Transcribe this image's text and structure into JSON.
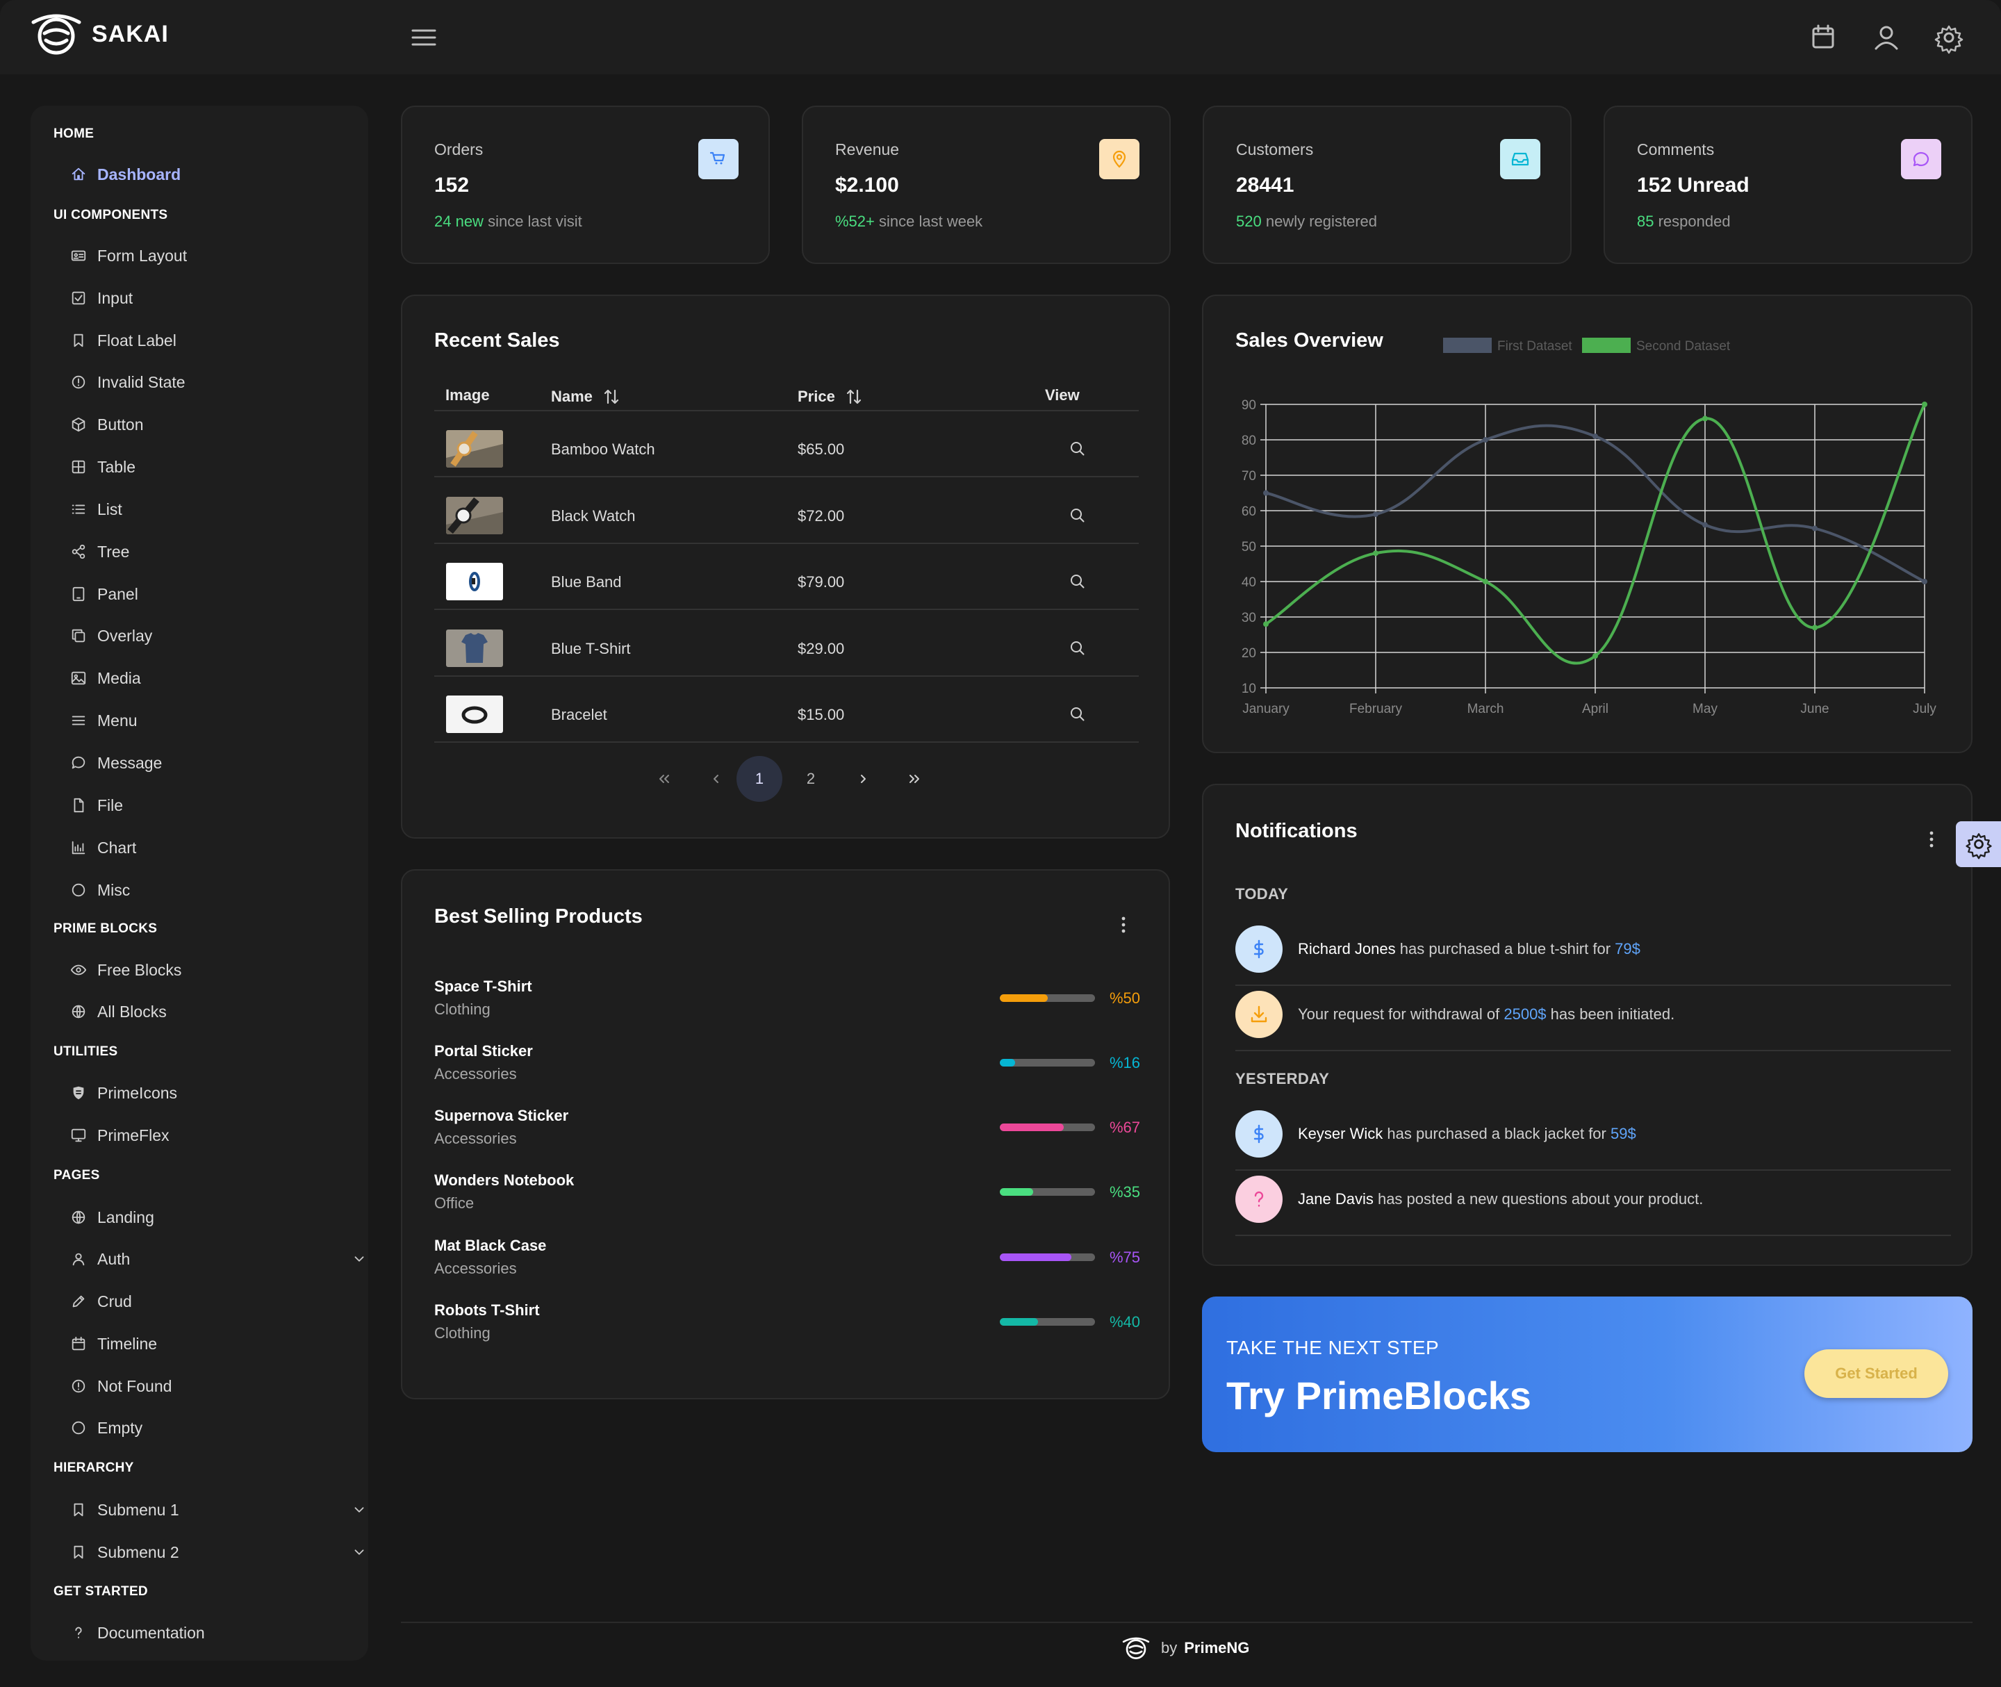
{
  "app": {
    "name": "SAKAI"
  },
  "sidebar": {
    "sections": [
      {
        "label": "HOME",
        "items": [
          {
            "label": "Dashboard",
            "icon": "home-icon"
          }
        ]
      },
      {
        "label": "UI COMPONENTS",
        "items": [
          {
            "label": "Form Layout",
            "icon": "id-card-icon"
          },
          {
            "label": "Input",
            "icon": "check-square-icon"
          },
          {
            "label": "Float Label",
            "icon": "bookmark-icon"
          },
          {
            "label": "Invalid State",
            "icon": "exclamation-circle-icon"
          },
          {
            "label": "Button",
            "icon": "box-icon"
          },
          {
            "label": "Table",
            "icon": "table-icon"
          },
          {
            "label": "List",
            "icon": "list-icon"
          },
          {
            "label": "Tree",
            "icon": "share-alt-icon"
          },
          {
            "label": "Panel",
            "icon": "tablet-icon"
          },
          {
            "label": "Overlay",
            "icon": "clone-icon"
          },
          {
            "label": "Media",
            "icon": "image-icon"
          },
          {
            "label": "Menu",
            "icon": "bars-icon"
          },
          {
            "label": "Message",
            "icon": "comment-icon"
          },
          {
            "label": "File",
            "icon": "file-icon"
          },
          {
            "label": "Chart",
            "icon": "chart-bar-icon"
          },
          {
            "label": "Misc",
            "icon": "circle-icon"
          }
        ]
      },
      {
        "label": "PRIME BLOCKS",
        "items": [
          {
            "label": "Free Blocks",
            "icon": "eye-icon"
          },
          {
            "label": "All Blocks",
            "icon": "globe-icon"
          }
        ]
      },
      {
        "label": "UTILITIES",
        "items": [
          {
            "label": "PrimeIcons",
            "icon": "prime-icon"
          },
          {
            "label": "PrimeFlex",
            "icon": "desktop-icon"
          }
        ]
      },
      {
        "label": "PAGES",
        "items": [
          {
            "label": "Landing",
            "icon": "globe-icon"
          },
          {
            "label": "Auth",
            "icon": "user-icon"
          },
          {
            "label": "Crud",
            "icon": "pencil-icon"
          },
          {
            "label": "Timeline",
            "icon": "calendar-icon"
          },
          {
            "label": "Not Found",
            "icon": "exclamation-circle-icon"
          },
          {
            "label": "Empty",
            "icon": "circle-icon"
          }
        ]
      },
      {
        "label": "HIERARCHY",
        "items": [
          {
            "label": "Submenu 1",
            "icon": "bookmark-icon"
          },
          {
            "label": "Submenu 2",
            "icon": "bookmark-icon"
          }
        ]
      },
      {
        "label": "GET STARTED",
        "items": [
          {
            "label": "Documentation",
            "icon": "question-icon"
          }
        ]
      }
    ]
  },
  "stats": [
    {
      "title": "Orders",
      "value": "152",
      "highlight": "24 new",
      "sub": " since last visit",
      "icon": "shopping-cart-icon",
      "icon_bg": "#cfe5fb",
      "icon_color": "#3b82f6"
    },
    {
      "title": "Revenue",
      "value": "$2.100",
      "highlight": "%52+",
      "sub": " since last week",
      "icon": "map-marker-icon",
      "icon_bg": "#fde2b8",
      "icon_color": "#f59e0b"
    },
    {
      "title": "Customers",
      "value": "28441",
      "highlight": "520",
      "sub": " newly registered",
      "icon": "inbox-icon",
      "icon_bg": "#c6eef6",
      "icon_color": "#06b6d4"
    },
    {
      "title": "Comments",
      "value": "152 Unread",
      "highlight": "85",
      "sub": " responded",
      "icon": "comment-icon",
      "icon_bg": "#ecd0f7",
      "icon_color": "#a855f7"
    }
  ],
  "recent_sales": {
    "title": "Recent Sales",
    "columns": {
      "image": "Image",
      "name": "Name",
      "price": "Price",
      "view": "View"
    },
    "rows": [
      {
        "name": "Bamboo Watch",
        "price": "$65.00"
      },
      {
        "name": "Black Watch",
        "price": "$72.00"
      },
      {
        "name": "Blue Band",
        "price": "$79.00"
      },
      {
        "name": "Blue T-Shirt",
        "price": "$29.00"
      },
      {
        "name": "Bracelet",
        "price": "$15.00"
      }
    ],
    "pages": [
      "1",
      "2"
    ],
    "current_page": "1"
  },
  "best_selling": {
    "title": "Best Selling Products",
    "items": [
      {
        "name": "Space T-Shirt",
        "category": "Clothing",
        "percent_label": "%50",
        "percent": 50,
        "color": "#f59e0b"
      },
      {
        "name": "Portal Sticker",
        "category": "Accessories",
        "percent_label": "%16",
        "percent": 16,
        "color": "#06b6d4"
      },
      {
        "name": "Supernova Sticker",
        "category": "Accessories",
        "percent_label": "%67",
        "percent": 67,
        "color": "#ec4899"
      },
      {
        "name": "Wonders Notebook",
        "category": "Office",
        "percent_label": "%35",
        "percent": 35,
        "color": "#4ade80"
      },
      {
        "name": "Mat Black Case",
        "category": "Accessories",
        "percent_label": "%75",
        "percent": 75,
        "color": "#a855f7"
      },
      {
        "name": "Robots T-Shirt",
        "category": "Clothing",
        "percent_label": "%40",
        "percent": 40,
        "color": "#14b8a6"
      }
    ]
  },
  "sales_overview": {
    "title": "Sales Overview"
  },
  "chart_data": {
    "type": "line",
    "title": "Sales Overview",
    "categories": [
      "January",
      "February",
      "March",
      "April",
      "May",
      "June",
      "July"
    ],
    "series": [
      {
        "name": "First Dataset",
        "values": [
          65,
          59,
          80,
          81,
          56,
          55,
          40
        ],
        "color": "#4b5568"
      },
      {
        "name": "Second Dataset",
        "values": [
          28,
          48,
          40,
          19,
          86,
          27,
          90
        ],
        "color": "#4caf50"
      }
    ],
    "ylim": [
      10,
      90
    ],
    "yticks": [
      10,
      20,
      30,
      40,
      50,
      60,
      70,
      80,
      90
    ],
    "grid": true,
    "legend": "top-center",
    "smooth": true
  },
  "notifications": {
    "title": "Notifications",
    "today_label": "TODAY",
    "yesterday_label": "YESTERDAY",
    "today": [
      {
        "icon": "dollar-icon",
        "bg": "#cfe5fb",
        "color": "#3b82f6",
        "strong": "Richard Jones",
        "text": " has purchased a blue t-shirt for ",
        "link": "79$",
        "tail": ""
      },
      {
        "icon": "download-icon",
        "bg": "#fde2b8",
        "color": "#f59e0b",
        "strong": "",
        "text": "Your request for withdrawal of ",
        "link": "2500$",
        "tail": " has been initiated."
      }
    ],
    "yesterday": [
      {
        "icon": "dollar-icon",
        "bg": "#cfe5fb",
        "color": "#3b82f6",
        "strong": "Keyser Wick",
        "text": " has purchased a black jacket for ",
        "link": "59$",
        "tail": ""
      },
      {
        "icon": "question-icon",
        "bg": "#fbcfe0",
        "color": "#ec4899",
        "strong": "Jane Davis",
        "text": " has posted a new questions about your product.",
        "link": "",
        "tail": ""
      }
    ]
  },
  "cta": {
    "subtitle": "TAKE THE NEXT STEP",
    "title": "Try PrimeBlocks",
    "button": "Get Started"
  },
  "footer": {
    "by": "by",
    "brand": "PrimeNG"
  }
}
